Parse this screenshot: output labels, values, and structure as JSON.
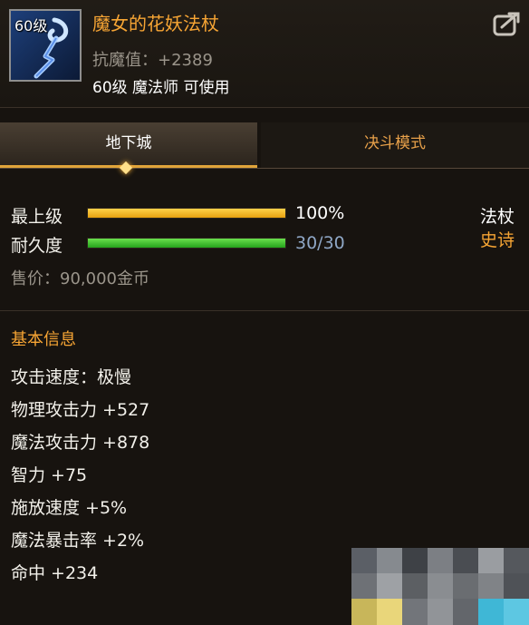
{
  "item": {
    "level_badge": "60级",
    "name": "魔女的花妖法杖",
    "magic_resist": "抗魔值：+2389",
    "requirement": "60级 魔法师 可使用",
    "icon": "magic-staff-icon",
    "share_icon": "share-icon"
  },
  "tabs": [
    {
      "label": "地下城",
      "active": true
    },
    {
      "label": "决斗模式",
      "active": false
    }
  ],
  "bars": {
    "max_level": {
      "label": "最上级",
      "value": "100%",
      "fraction": 1.0
    },
    "durability": {
      "label": "耐久度",
      "value": "30/30",
      "fraction": 1.0
    }
  },
  "type_info": {
    "type": "法杖",
    "grade": "史诗"
  },
  "price": "售价：90,000金币",
  "basic_info": {
    "title": "基本信息",
    "attributes": [
      "攻击速度：极慢",
      "物理攻击力 +527",
      "魔法攻击力 +878",
      "智力 +75",
      "施放速度 +5%",
      "魔法暴击率 +2%",
      "命中 +234"
    ]
  },
  "colors": {
    "name": "#f7a534",
    "epic": "#f7a534",
    "durability_value": "#8fa7c6",
    "bar_orange": "#f0b320",
    "bar_green": "#3fc233"
  }
}
